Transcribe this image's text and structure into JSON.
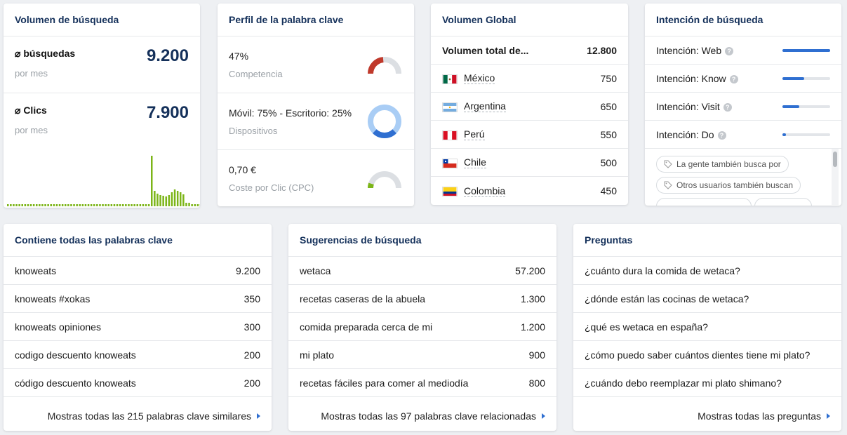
{
  "search_volume": {
    "title": "Volumen de búsqueda",
    "searches_label": "⌀ búsquedas",
    "searches_sub": "por mes",
    "searches_value": "9.200",
    "clicks_label": "⌀ Clics",
    "clicks_sub": "por mes",
    "clicks_value": "7.900",
    "bar_color": "#7cb518"
  },
  "keyword_profile": {
    "title": "Perfil de la palabra clave",
    "competition_value": "47%",
    "competition_label": "Competencia",
    "competition_fraction": 0.47,
    "devices_value": "Móvil: 75% - Escritorio: 25%",
    "devices_label": "Dispositivos",
    "mobile_fraction": 0.75,
    "cpc_value": "0,70 €",
    "cpc_label": "Coste por Clic (CPC)",
    "cpc_fraction": 0.1
  },
  "global_volume": {
    "title": "Volumen Global",
    "total_label": "Volumen total de...",
    "total_value": "12.800",
    "countries": [
      {
        "name": "México",
        "value": "750"
      },
      {
        "name": "Argentina",
        "value": "650"
      },
      {
        "name": "Perú",
        "value": "550"
      },
      {
        "name": "Chile",
        "value": "500"
      },
      {
        "name": "Colombia",
        "value": "450"
      }
    ]
  },
  "search_intent": {
    "title": "Intención de búsqueda",
    "intents": [
      {
        "label": "Intención: Web",
        "level": 1.0
      },
      {
        "label": "Intención: Know",
        "level": 0.45
      },
      {
        "label": "Intención: Visit",
        "level": 0.35
      },
      {
        "label": "Intención: Do",
        "level": 0.08
      }
    ],
    "chips": [
      "La gente también busca por",
      "Otros usuarios también buscan"
    ]
  },
  "all_keywords": {
    "title": "Contiene todas las palabras clave",
    "rows": [
      {
        "kw": "knoweats",
        "vol": "9.200"
      },
      {
        "kw": "knoweats #xokas",
        "vol": "350"
      },
      {
        "kw": "knoweats opiniones",
        "vol": "300"
      },
      {
        "kw": "codigo descuento knoweats",
        "vol": "200"
      },
      {
        "kw": "código descuento knoweats",
        "vol": "200"
      }
    ],
    "link": "Mostras todas las 215 palabras clave similares"
  },
  "suggestions": {
    "title": "Sugerencias de búsqueda",
    "rows": [
      {
        "kw": "wetaca",
        "vol": "57.200"
      },
      {
        "kw": "recetas caseras de la abuela",
        "vol": "1.300"
      },
      {
        "kw": "comida preparada cerca de mi",
        "vol": "1.200"
      },
      {
        "kw": "mi plato",
        "vol": "900"
      },
      {
        "kw": "recetas fáciles para comer al mediodía",
        "vol": "800"
      }
    ],
    "link": "Mostras todas las 97 palabras clave relacionadas"
  },
  "questions": {
    "title": "Preguntas",
    "rows": [
      "¿cuánto dura la comida de wetaca?",
      "¿dónde están las cocinas de wetaca?",
      "¿qué es wetaca en españa?",
      "¿cómo puedo saber cuántos dientes tiene mi plato?",
      "¿cuándo debo reemplazar mi plato shimano?"
    ],
    "link": "Mostras todas las preguntas"
  }
}
